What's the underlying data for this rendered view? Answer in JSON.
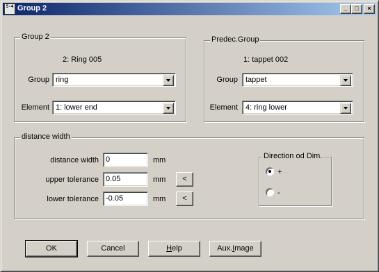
{
  "window": {
    "title": "Group 2",
    "icon_text": "5-4",
    "minimize_glyph": "_",
    "maximize_glyph": "□",
    "close_glyph": "×"
  },
  "group2": {
    "title": "Group 2",
    "subtitle": "2: Ring 005",
    "group_label": "Group",
    "group_value": "ring",
    "element_label": "Element",
    "element_value": "1: lower end"
  },
  "predec": {
    "title": "Predec.Group",
    "subtitle": "1: tappet 002",
    "group_label": "Group",
    "group_value": "tappet",
    "element_label": "Element",
    "element_value": "4: ring lower"
  },
  "distance": {
    "title": "distance width",
    "rows": [
      {
        "label": "distance width",
        "value": "0",
        "unit": "mm",
        "has_button": false
      },
      {
        "label": "upper tolerance",
        "value": "0.05",
        "unit": "mm",
        "has_button": true,
        "button": "<"
      },
      {
        "label": "lower tolerance",
        "value": "-0.05",
        "unit": "mm",
        "has_button": true,
        "button": "<"
      }
    ],
    "direction": {
      "title": "Direction od Dim.",
      "options": [
        {
          "label": "+",
          "selected": true
        },
        {
          "label": "-",
          "selected": false
        }
      ]
    }
  },
  "buttons": {
    "ok": "OK",
    "cancel": "Cancel",
    "help_prefix": "",
    "help_mnemonic": "H",
    "help_rest": "elp",
    "aux_prefix": "Aux. ",
    "aux_mnemonic": "I",
    "aux_rest": "mage"
  }
}
